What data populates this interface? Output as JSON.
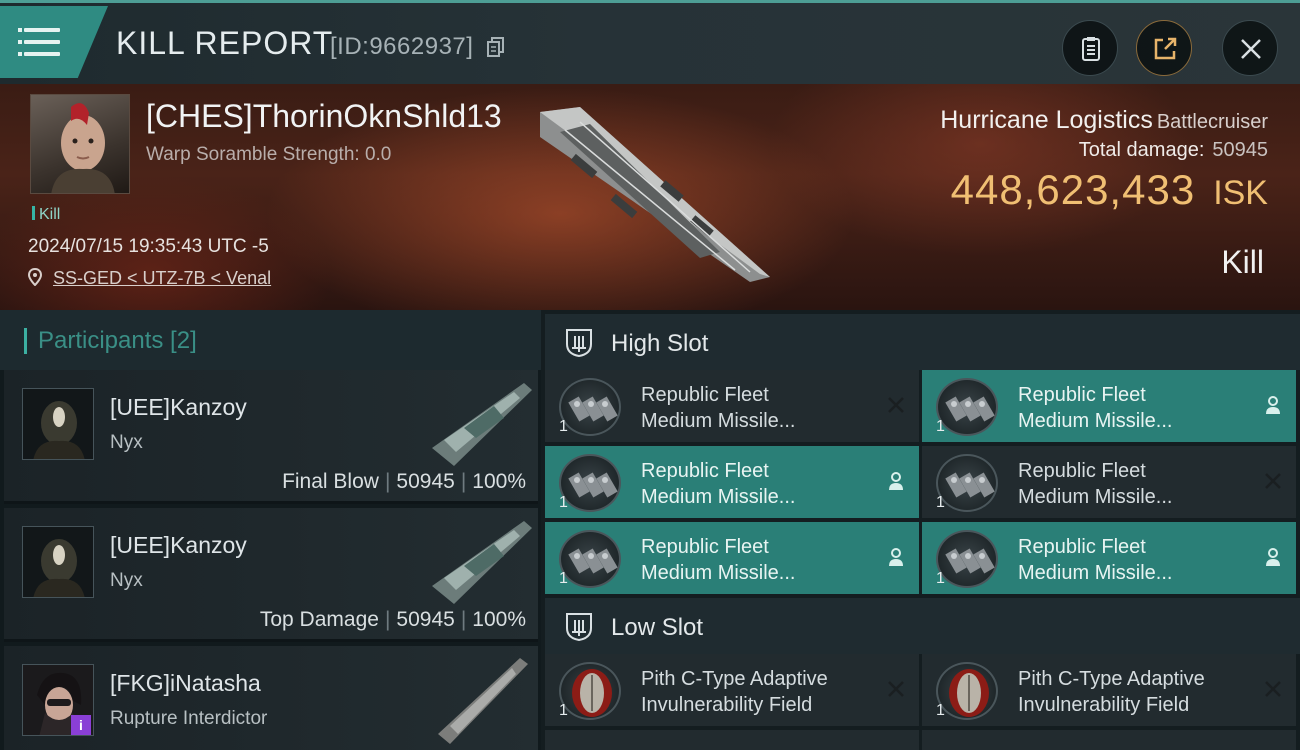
{
  "header": {
    "title": "KILL REPORT",
    "id_text": "[ID:9662937]",
    "buttons": [
      {
        "name": "clipboard-icon"
      },
      {
        "name": "share-icon"
      },
      {
        "name": "close-icon"
      }
    ]
  },
  "victim": {
    "name": "[CHES]ThorinOknShld13",
    "scramble": "Warp Soramble Strength: 0.0",
    "tag": "Kill",
    "datetime": "2024/07/15 19:35:43 UTC -5",
    "location": "SS-GED < UTZ-7B < Venal",
    "ship_name": "Hurricane Logistics",
    "ship_class": "Battlecruiser",
    "damage_label": "Total damage:",
    "damage_value": "50945",
    "isk_value": "448,623,433",
    "isk_unit": "ISK",
    "result": "Kill"
  },
  "participants": {
    "title": "Participants [2]",
    "rows": [
      {
        "name": "[UEE]Kanzoy",
        "ship": "Nyx",
        "role": "Final Blow",
        "damage": "50945",
        "percent": "100%"
      },
      {
        "name": "[UEE]Kanzoy",
        "ship": "Nyx",
        "role": "Top Damage",
        "damage": "50945",
        "percent": "100%"
      },
      {
        "name": "[FKG]iNatasha",
        "ship": "Rupture Interdictor",
        "role": "",
        "damage": "",
        "percent": ""
      }
    ]
  },
  "slots": {
    "high": {
      "label": "High Slot",
      "items": [
        {
          "line1": "Republic Fleet",
          "line2": "Medium Missile...",
          "qty": "1",
          "state": "destroyed"
        },
        {
          "line1": "Republic Fleet",
          "line2": "Medium Missile...",
          "qty": "1",
          "state": "dropped"
        },
        {
          "line1": "Republic Fleet",
          "line2": "Medium Missile...",
          "qty": "1",
          "state": "dropped"
        },
        {
          "line1": "Republic Fleet",
          "line2": "Medium Missile...",
          "qty": "1",
          "state": "destroyed"
        },
        {
          "line1": "Republic Fleet",
          "line2": "Medium Missile...",
          "qty": "1",
          "state": "dropped"
        },
        {
          "line1": "Republic Fleet",
          "line2": "Medium Missile...",
          "qty": "1",
          "state": "dropped"
        }
      ]
    },
    "low": {
      "label": "Low Slot",
      "items": [
        {
          "line1": "Pith C-Type Adaptive",
          "line2": "Invulnerability Field",
          "qty": "1",
          "state": "destroyed"
        },
        {
          "line1": "Pith C-Type Adaptive",
          "line2": "Invulnerability Field",
          "qty": "1",
          "state": "destroyed"
        }
      ]
    }
  },
  "colors": {
    "accent": "#2a7f77",
    "isk": "#f0bf73",
    "participants_title": "#3a8f86"
  }
}
